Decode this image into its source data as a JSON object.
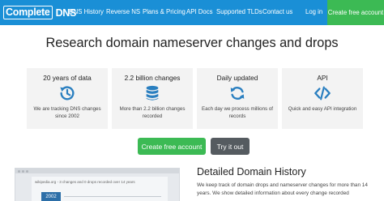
{
  "nav": {
    "logo_part1": "Complete",
    "logo_part2": "DNS",
    "links": [
      "DNS History",
      "Reverse NS",
      "Plans & Pricing",
      "API Docs",
      "Supported TLDs",
      "Contact us",
      "Log in"
    ],
    "cta": "Create free account"
  },
  "hero": {
    "title": "Research domain nameserver changes and drops"
  },
  "features": [
    {
      "title": "20 years of data",
      "icon": "history-icon",
      "desc": "We are tracking DNS changes since 2002"
    },
    {
      "title": "2.2 billion changes",
      "icon": "database-icon",
      "desc": "More than 2.2 billion changes recorded"
    },
    {
      "title": "Daily updated",
      "icon": "refresh-icon",
      "desc": "Each day we process millions of records"
    },
    {
      "title": "API",
      "icon": "code-icon",
      "desc": "Quick and easy API integration"
    }
  ],
  "buttons": {
    "create": "Create free account",
    "try": "Try it out"
  },
  "preview": {
    "text": "wikipedia.org - 3 changes and 0 drops recorded over 14 years",
    "year": "2002"
  },
  "history": {
    "title": "Detailed Domain History",
    "desc": "We keep track of domain drops and nameserver changes for more than 14 years. We show detailed information about every change recorded"
  },
  "colors": {
    "nav": "#1a8fd6",
    "cta_green": "#3cba54",
    "icon_blue": "#2a7fc0",
    "try_gray": "#555b60"
  }
}
